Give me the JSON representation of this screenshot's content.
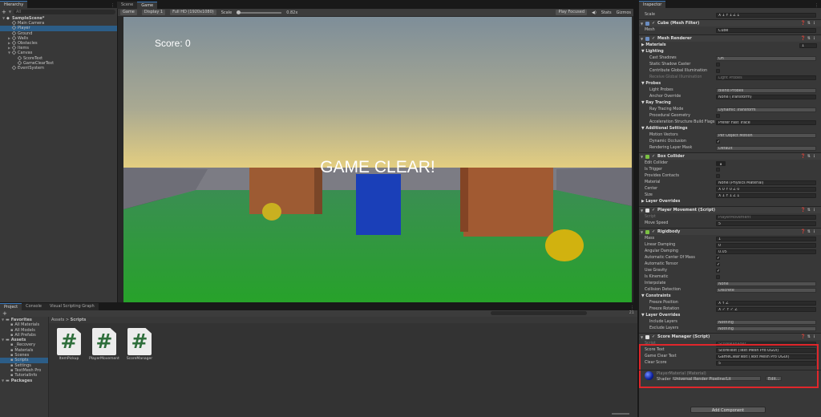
{
  "hierarchy": {
    "tab": "Hierarchy",
    "search_placeholder": "All",
    "items": [
      {
        "label": "SampleScene*",
        "depth": 0,
        "kind": "scene",
        "arrow": "▼"
      },
      {
        "label": "Main Camera",
        "depth": 1,
        "kind": "cube",
        "arrow": ""
      },
      {
        "label": "Player",
        "depth": 1,
        "kind": "cube",
        "arrow": ""
      },
      {
        "label": "Ground",
        "depth": 1,
        "kind": "cube",
        "arrow": ""
      },
      {
        "label": "Walls",
        "depth": 1,
        "kind": "cube",
        "arrow": "▶"
      },
      {
        "label": "Obstacles",
        "depth": 1,
        "kind": "cube",
        "arrow": "▶"
      },
      {
        "label": "Items",
        "depth": 1,
        "kind": "cube",
        "arrow": "▶"
      },
      {
        "label": "Canvas",
        "depth": 1,
        "kind": "cube",
        "arrow": "▼"
      },
      {
        "label": "ScoreText",
        "depth": 2,
        "kind": "cube",
        "arrow": ""
      },
      {
        "label": "GameClearText",
        "depth": 2,
        "kind": "cube",
        "arrow": ""
      },
      {
        "label": "EventSystem",
        "depth": 1,
        "kind": "cube",
        "arrow": ""
      }
    ]
  },
  "game": {
    "tabs": [
      "Scene",
      "Game"
    ],
    "toolbar": {
      "mode": "Game",
      "display": "Display 1",
      "resolution": "Full HD (1920x1080)",
      "scale_label": "Scale",
      "scale_value": "0.82x",
      "play_mode": "Play Focused",
      "stats": "Stats",
      "gizmos": "Gizmos"
    },
    "score_text": "Score: 0",
    "clear_text": "GAME CLEAR!"
  },
  "project": {
    "tabs": [
      "Project",
      "Console",
      "Visual Scripting Graph"
    ],
    "tree": [
      {
        "label": "Favorites",
        "depth": 0,
        "bold": true
      },
      {
        "label": "All Materials",
        "depth": 1,
        "bold": false
      },
      {
        "label": "All Models",
        "depth": 1,
        "bold": false
      },
      {
        "label": "All Prefabs",
        "depth": 1,
        "bold": false
      },
      {
        "label": "Assets",
        "depth": 0,
        "bold": true
      },
      {
        "label": "_Recovery",
        "depth": 1,
        "bold": false
      },
      {
        "label": "Materials",
        "depth": 1,
        "bold": false
      },
      {
        "label": "Scenes",
        "depth": 1,
        "bold": false
      },
      {
        "label": "Scripts",
        "depth": 1,
        "bold": false
      },
      {
        "label": "Settings",
        "depth": 1,
        "bold": false
      },
      {
        "label": "TextMesh Pro",
        "depth": 1,
        "bold": false
      },
      {
        "label": "TutorialInfo",
        "depth": 1,
        "bold": false
      },
      {
        "label": "Packages",
        "depth": 0,
        "bold": true
      }
    ],
    "breadcrumb": [
      "Assets",
      "Scripts"
    ],
    "count": "21",
    "files": [
      "ItemPickup",
      "PlayerMovement",
      "ScoreManager"
    ]
  },
  "inspector": {
    "tab": "Inspector",
    "rows": [
      {
        "t": "row",
        "label": "Scale",
        "value": "X 1    Y 1    Z 1"
      },
      {
        "t": "head",
        "label": "Cube (Mesh Filter)",
        "color": "#6a8dc2"
      },
      {
        "t": "row",
        "label": "Mesh",
        "value": "Cube"
      },
      {
        "t": "head",
        "label": "Mesh Renderer",
        "color": "#6a8dc2"
      },
      {
        "t": "sect",
        "label": "▶ Materials",
        "value": "1"
      },
      {
        "t": "sect",
        "label": "▼ Lighting"
      },
      {
        "t": "row",
        "label": "Cast Shadows",
        "value": "On",
        "dd": true,
        "ind": true
      },
      {
        "t": "chk",
        "label": "Static Shadow Caster",
        "ind": true,
        "checked": false
      },
      {
        "t": "chk",
        "label": "Contribute Global Illumination",
        "ind": true,
        "checked": false
      },
      {
        "t": "row",
        "label": "Receive Global Illumination",
        "value": "Light Probes",
        "dim": true,
        "ind": true
      },
      {
        "t": "sect",
        "label": "▼ Probes"
      },
      {
        "t": "row",
        "label": "Light Probes",
        "value": "Blend Probes",
        "dd": true,
        "ind": true
      },
      {
        "t": "row",
        "label": "Anchor Override",
        "value": "None (Transform)",
        "ind": true
      },
      {
        "t": "sect",
        "label": "▼ Ray Tracing"
      },
      {
        "t": "row",
        "label": "Ray Tracing Mode",
        "value": "Dynamic Transform",
        "dd": true,
        "ind": true
      },
      {
        "t": "chk",
        "label": "Procedural Geometry",
        "ind": true,
        "checked": false
      },
      {
        "t": "row",
        "label": "Acceleration Structure Build Flags",
        "value": "Prefer Fast Trace",
        "ind": true
      },
      {
        "t": "sect",
        "label": "▼ Additional Settings"
      },
      {
        "t": "row",
        "label": "Motion Vectors",
        "value": "Per Object Motion",
        "dd": true,
        "ind": true
      },
      {
        "t": "chk",
        "label": "Dynamic Occlusion",
        "ind": true,
        "checked": true
      },
      {
        "t": "row",
        "label": "Rendering Layer Mask",
        "value": "Default",
        "dd": true,
        "ind": true
      },
      {
        "t": "head",
        "label": "Box Collider",
        "color": "#7bc043"
      },
      {
        "t": "row",
        "label": "Edit Collider",
        "value": ""
      },
      {
        "t": "chk",
        "label": "Is Trigger",
        "checked": false
      },
      {
        "t": "chk",
        "label": "Provides Contacts",
        "checked": false
      },
      {
        "t": "row",
        "label": "Material",
        "value": "None (Physics Material)"
      },
      {
        "t": "row",
        "label": "Center",
        "value": "X 0    Y 0    Z 0"
      },
      {
        "t": "row",
        "label": "Size",
        "value": "X 1    Y 1    Z 1"
      },
      {
        "t": "sect",
        "label": "▶ Layer Overrides"
      },
      {
        "t": "head",
        "label": "Player Movement (Script)",
        "color": "#dddddd"
      },
      {
        "t": "row",
        "label": "Script",
        "value": "PlayerMovement",
        "dim": true
      },
      {
        "t": "row",
        "label": "Move Speed",
        "value": "5"
      },
      {
        "t": "head",
        "label": "Rigidbody",
        "color": "#7bc043"
      },
      {
        "t": "row",
        "label": "Mass",
        "value": "1"
      },
      {
        "t": "row",
        "label": "Linear Damping",
        "value": "0"
      },
      {
        "t": "row",
        "label": "Angular Damping",
        "value": "0.05"
      },
      {
        "t": "chk",
        "label": "Automatic Center Of Mass",
        "checked": true
      },
      {
        "t": "chk",
        "label": "Automatic Tensor",
        "checked": true
      },
      {
        "t": "chk",
        "label": "Use Gravity",
        "checked": true
      },
      {
        "t": "chk",
        "label": "Is Kinematic",
        "checked": false
      },
      {
        "t": "row",
        "label": "Interpolate",
        "value": "None",
        "dd": true
      },
      {
        "t": "row",
        "label": "Collision Detection",
        "value": "Discrete",
        "dd": true
      },
      {
        "t": "sect",
        "label": "▼ Constraints"
      },
      {
        "t": "row",
        "label": "Freeze Position",
        "value": "X   Y   Z",
        "ind": true
      },
      {
        "t": "row",
        "label": "Freeze Rotation",
        "value": "X ✓ Y ✓ Z",
        "ind": true
      },
      {
        "t": "sect",
        "label": "▼ Layer Overrides"
      },
      {
        "t": "row",
        "label": "Include Layers",
        "value": "Nothing",
        "dd": true,
        "ind": true
      },
      {
        "t": "row",
        "label": "Exclude Layers",
        "value": "Nothing",
        "dd": true,
        "ind": true
      },
      {
        "t": "head",
        "label": "Score Manager (Script)",
        "color": "#dddddd"
      },
      {
        "t": "row",
        "label": "Script",
        "value": "ScoreManager",
        "dim": true
      },
      {
        "t": "row",
        "label": "Score Text",
        "value": "ScoreText (Text Mesh Pro UGUI)"
      },
      {
        "t": "row",
        "label": "Game Clear Text",
        "value": "GameClearText (Text Mesh Pro UGUI)"
      },
      {
        "t": "row",
        "label": "Clear Score",
        "value": "5"
      }
    ],
    "material_name": "PlayerMaterial (Material)",
    "shader_label": "Shader",
    "shader_value": "Universal Render Pipeline/Lit",
    "edit_label": "Edit...",
    "add_component": "Add Component",
    "highlight_color": "#e0262b"
  }
}
